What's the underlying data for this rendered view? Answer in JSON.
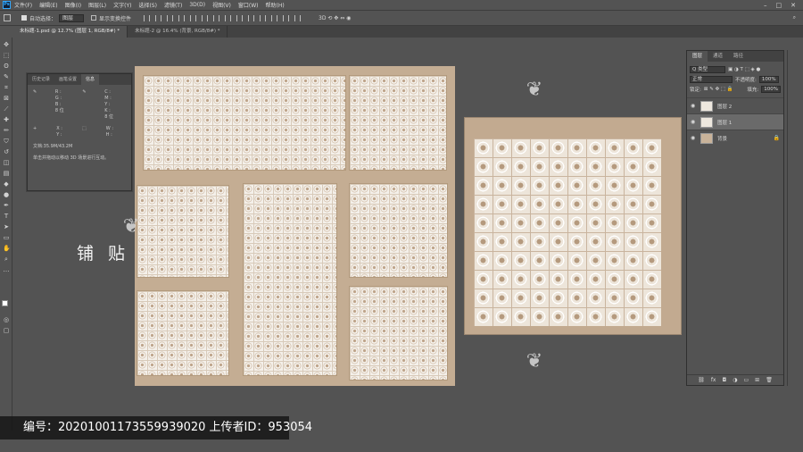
{
  "menu": [
    "文件(F)",
    "编辑(E)",
    "图像(I)",
    "图层(L)",
    "文字(Y)",
    "选择(S)",
    "滤镜(T)",
    "3D(D)",
    "视图(V)",
    "窗口(W)",
    "帮助(H)"
  ],
  "options": {
    "auto_select_label": "自动选择：",
    "auto_select_value": "图层",
    "show_transform_label": "显示变换控件"
  },
  "tabs": [
    {
      "label": "未标题-1.psd @ 12.7% (图层 1, RGB/8#) *",
      "active": true
    },
    {
      "label": "未标题-2 @ 16.4% (背景, RGB/8#) *",
      "active": false
    }
  ],
  "info_panel": {
    "tabs": [
      "历史记录",
      "画笔设置",
      "信息"
    ],
    "rgb": [
      "R :",
      "G :",
      "B :"
    ],
    "cmyk": [
      "C :",
      "M :",
      "Y :",
      "K :"
    ],
    "bit1": "8 位",
    "bit2": "8 位",
    "xy": [
      "X :",
      "Y :"
    ],
    "wh": [
      "W :",
      "H :"
    ],
    "doc": "文档:35.9M/43.2M",
    "hint": "单击并拖动以移动 3D 场景进行互动。"
  },
  "canvas_label": "铺 贴",
  "layers_panel": {
    "tabs": [
      "图层",
      "通道",
      "路径"
    ],
    "filter": "Q 类型",
    "blend_mode": "正常",
    "opacity_label": "不透明度:",
    "opacity": "100%",
    "lock_label": "锁定:",
    "fill_label": "填充:",
    "fill": "100%",
    "layers": [
      {
        "name": "图层 2",
        "selected": false,
        "locked": false
      },
      {
        "name": "图层 1",
        "selected": true,
        "locked": false
      },
      {
        "name": "背景",
        "selected": false,
        "locked": true
      }
    ]
  },
  "footer_watermark": "编号：20201001173559939020 上传者ID：953054"
}
